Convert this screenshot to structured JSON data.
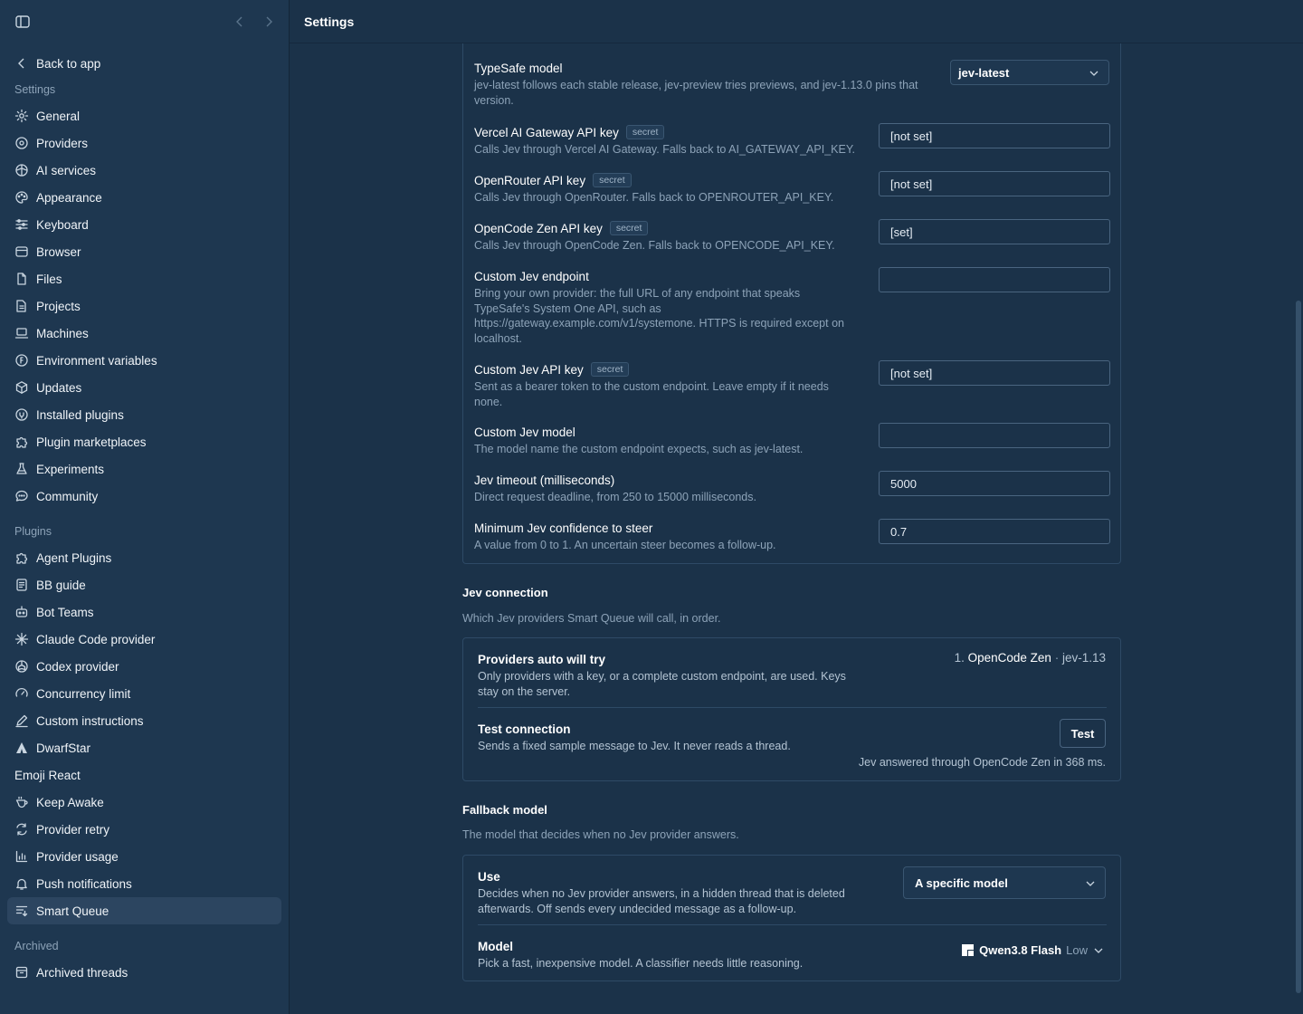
{
  "header": {
    "title": "Settings"
  },
  "sidebar": {
    "back_label": "Back to app",
    "sections": {
      "settings": "Settings",
      "plugins": "Plugins",
      "archived": "Archived"
    },
    "settings_items": [
      {
        "label": "General",
        "icon": "gear-icon"
      },
      {
        "label": "Providers",
        "icon": "providers-icon"
      },
      {
        "label": "AI services",
        "icon": "ai-services-icon"
      },
      {
        "label": "Appearance",
        "icon": "palette-icon"
      },
      {
        "label": "Keyboard",
        "icon": "sliders-icon"
      },
      {
        "label": "Browser",
        "icon": "browser-icon"
      },
      {
        "label": "Files",
        "icon": "file-icon"
      },
      {
        "label": "Projects",
        "icon": "folder-icon"
      },
      {
        "label": "Machines",
        "icon": "laptop-icon"
      },
      {
        "label": "Environment variables",
        "icon": "env-icon"
      },
      {
        "label": "Updates",
        "icon": "package-icon"
      },
      {
        "label": "Installed plugins",
        "icon": "plugin-icon"
      },
      {
        "label": "Plugin marketplaces",
        "icon": "puzzle-icon"
      },
      {
        "label": "Experiments",
        "icon": "flask-icon"
      },
      {
        "label": "Community",
        "icon": "chat-icon"
      }
    ],
    "plugin_items": [
      {
        "label": "Agent Plugins",
        "icon": "puzzle-icon"
      },
      {
        "label": "BB guide",
        "icon": "guide-icon"
      },
      {
        "label": "Bot Teams",
        "icon": "bot-icon"
      },
      {
        "label": "Claude Code provider",
        "icon": "sparkle-icon"
      },
      {
        "label": "Codex provider",
        "icon": "openai-icon"
      },
      {
        "label": "Concurrency limit",
        "icon": "gauge-icon"
      },
      {
        "label": "Custom instructions",
        "icon": "pen-icon"
      },
      {
        "label": "DwarfStar",
        "icon": "dwarfstar-icon"
      },
      {
        "label": "Emoji React",
        "icon": ""
      },
      {
        "label": "Keep Awake",
        "icon": "cup-icon"
      },
      {
        "label": "Provider retry",
        "icon": "retry-icon"
      },
      {
        "label": "Provider usage",
        "icon": "bar-chart-icon"
      },
      {
        "label": "Push notifications",
        "icon": "bell-icon"
      },
      {
        "label": "Smart Queue",
        "icon": "queue-icon"
      }
    ],
    "archived_items": [
      {
        "label": "Archived threads",
        "icon": "archive-icon"
      }
    ],
    "active": "Smart Queue"
  },
  "jev_settings": {
    "typesafe_model": {
      "label": "TypeSafe model",
      "desc": "jev-latest follows each stable release, jev-preview tries previews, and jev-1.13.0 pins that version.",
      "value": "jev-latest"
    },
    "vercel_key": {
      "label": "Vercel AI Gateway API key",
      "badge": "secret",
      "desc": "Calls Jev through Vercel AI Gateway. Falls back to AI_GATEWAY_API_KEY.",
      "value": "[not set]"
    },
    "openrouter_key": {
      "label": "OpenRouter API key",
      "badge": "secret",
      "desc": "Calls Jev through OpenRouter. Falls back to OPENROUTER_API_KEY.",
      "value": "[not set]"
    },
    "opencode_key": {
      "label": "OpenCode Zen API key",
      "badge": "secret",
      "desc": "Calls Jev through OpenCode Zen. Falls back to OPENCODE_API_KEY.",
      "value": "[set]"
    },
    "custom_endpoint": {
      "label": "Custom Jev endpoint",
      "desc": "Bring your own provider: the full URL of any endpoint that speaks TypeSafe's System One API, such as https://gateway.example.com/v1/systemone. HTTPS is required except on localhost.",
      "value": ""
    },
    "custom_key": {
      "label": "Custom Jev API key",
      "badge": "secret",
      "desc": "Sent as a bearer token to the custom endpoint. Leave empty if it needs none.",
      "value": "[not set]"
    },
    "custom_model": {
      "label": "Custom Jev model",
      "desc": "The model name the custom endpoint expects, such as jev-latest.",
      "value": ""
    },
    "timeout": {
      "label": "Jev timeout (milliseconds)",
      "desc": "Direct request deadline, from 250 to 15000 milliseconds.",
      "value": "5000"
    },
    "confidence": {
      "label": "Minimum Jev confidence to steer",
      "desc": "A value from 0 to 1. An uncertain steer becomes a follow-up.",
      "value": "0.7"
    }
  },
  "jev_connection": {
    "title": "Jev connection",
    "desc": "Which Jev providers Smart Queue will call, in order.",
    "providers": {
      "label": "Providers auto will try",
      "desc": "Only providers with a key, or a complete custom endpoint, are used. Keys stay on the server.",
      "order": "1.",
      "provider": "OpenCode Zen",
      "sep": "·",
      "model": "jev-1.13"
    },
    "test": {
      "label": "Test connection",
      "desc": "Sends a fixed sample message to Jev. It never reads a thread.",
      "button": "Test",
      "result": "Jev answered through OpenCode Zen in 368 ms."
    }
  },
  "fallback": {
    "title": "Fallback model",
    "desc": "The model that decides when no Jev provider answers.",
    "use": {
      "label": "Use",
      "desc": "Decides when no Jev provider answers, in a hidden thread that is deleted afterwards. Off sends every undecided message as a follow-up.",
      "value": "A specific model"
    },
    "model": {
      "label": "Model",
      "desc": "Pick a fast, inexpensive model. A classifier needs little reasoning.",
      "name": "Qwen3.8 Flash",
      "effort": "Low"
    }
  }
}
